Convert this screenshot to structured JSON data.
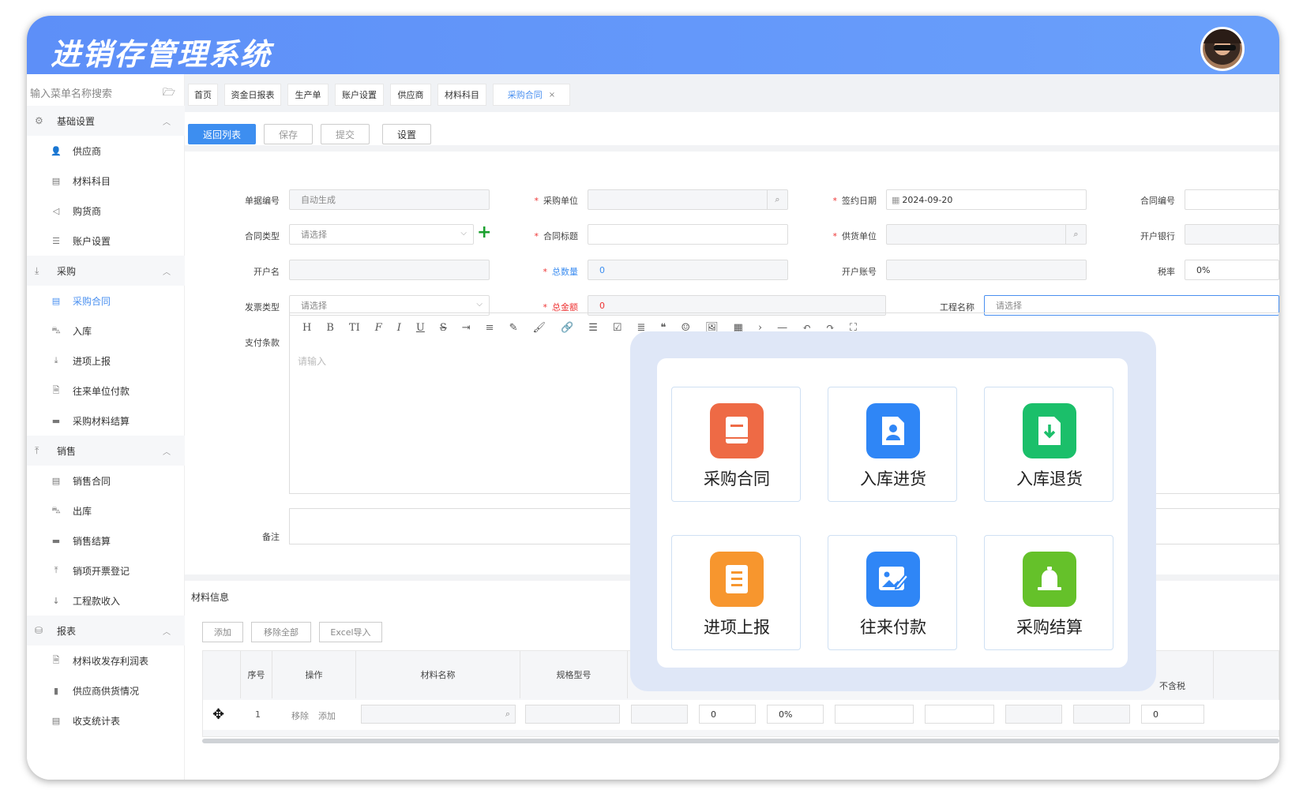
{
  "app": {
    "title": "进销存管理系统"
  },
  "sidebar": {
    "search_placeholder": "输入菜单名称搜索",
    "groups": [
      {
        "label": "基础设置",
        "items": [
          "供应商",
          "材料科目",
          "购货商",
          "账户设置"
        ]
      },
      {
        "label": "采购",
        "items": [
          "采购合同",
          "入库",
          "进项上报",
          "往来单位付款",
          "采购材料结算"
        ]
      },
      {
        "label": "销售",
        "items": [
          "销售合同",
          "出库",
          "销售结算",
          "销项开票登记",
          "工程款收入"
        ]
      },
      {
        "label": "报表",
        "items": [
          "材料收发存利润表",
          "供应商供货情况",
          "收支统计表"
        ]
      }
    ],
    "active_item": "采购合同"
  },
  "tabs": [
    {
      "label": "首页"
    },
    {
      "label": "资金日报表"
    },
    {
      "label": "生产单"
    },
    {
      "label": "账户设置"
    },
    {
      "label": "供应商"
    },
    {
      "label": "材料科目"
    },
    {
      "label": "采购合同",
      "active": true,
      "close": "×"
    }
  ],
  "toolbar": {
    "back": "返回列表",
    "save": "保存",
    "submit": "提交",
    "settings": "设置"
  },
  "form": {
    "doc_no": {
      "label": "单据编号",
      "value": "自动生成"
    },
    "purchaser": {
      "label": "采购单位",
      "value": ""
    },
    "sign_date": {
      "label": "签约日期",
      "value": "2024-09-20"
    },
    "contract_no": {
      "label": "合同编号",
      "value": ""
    },
    "contract_type": {
      "label": "合同类型",
      "placeholder": "请选择"
    },
    "contract_title": {
      "label": "合同标题",
      "value": ""
    },
    "supplier": {
      "label": "供货单位",
      "value": ""
    },
    "bank": {
      "label": "开户银行",
      "value": ""
    },
    "account_name": {
      "label": "开户名",
      "value": ""
    },
    "total_qty": {
      "label": "总数量",
      "value": "0"
    },
    "account_no": {
      "label": "开户账号",
      "value": ""
    },
    "tax_rate": {
      "label": "税率",
      "value": "0%"
    },
    "invoice_type": {
      "label": "发票类型",
      "placeholder": "请选择"
    },
    "total_amount": {
      "label": "总金额",
      "value": "0"
    },
    "project_name": {
      "label": "工程名称",
      "placeholder": "请选择"
    },
    "payment_terms": {
      "label": "支付条款",
      "placeholder": "请输入"
    },
    "remark": {
      "label": "备注",
      "value": ""
    }
  },
  "editor_tools": [
    "H",
    "B",
    "TI",
    "F",
    "I",
    "U",
    "S",
    "⇥",
    "≡",
    "✎",
    "🖌",
    "🔗",
    "☰",
    "☑",
    "≣",
    "❝",
    "☺",
    "🖼",
    "▦",
    "›",
    "—",
    "↶",
    "↷",
    "⛶"
  ],
  "materials": {
    "title": "材料信息",
    "buttons": [
      "添加",
      "移除全部",
      "Excel导入"
    ],
    "columns": [
      "序号",
      "操作",
      "材料名称",
      "规格型号",
      "不含税"
    ],
    "row": {
      "index": "1",
      "remove": "移除",
      "add": "添加",
      "qty": "0",
      "rate": "0%",
      "untaxed": "0"
    }
  },
  "popup": {
    "cards": [
      {
        "label": "采购合同",
        "color": "#ee6a45",
        "icon": "book-icon"
      },
      {
        "label": "入库进货",
        "color": "#2f86f6",
        "icon": "person-doc-icon"
      },
      {
        "label": "入库退货",
        "color": "#1bbf6a",
        "icon": "download-doc-icon"
      },
      {
        "label": "进项上报",
        "color": "#f7962e",
        "icon": "list-doc-icon"
      },
      {
        "label": "往来付款",
        "color": "#2f86f6",
        "icon": "image-edit-icon"
      },
      {
        "label": "采购结算",
        "color": "#65c12a",
        "icon": "bell-icon"
      }
    ]
  }
}
